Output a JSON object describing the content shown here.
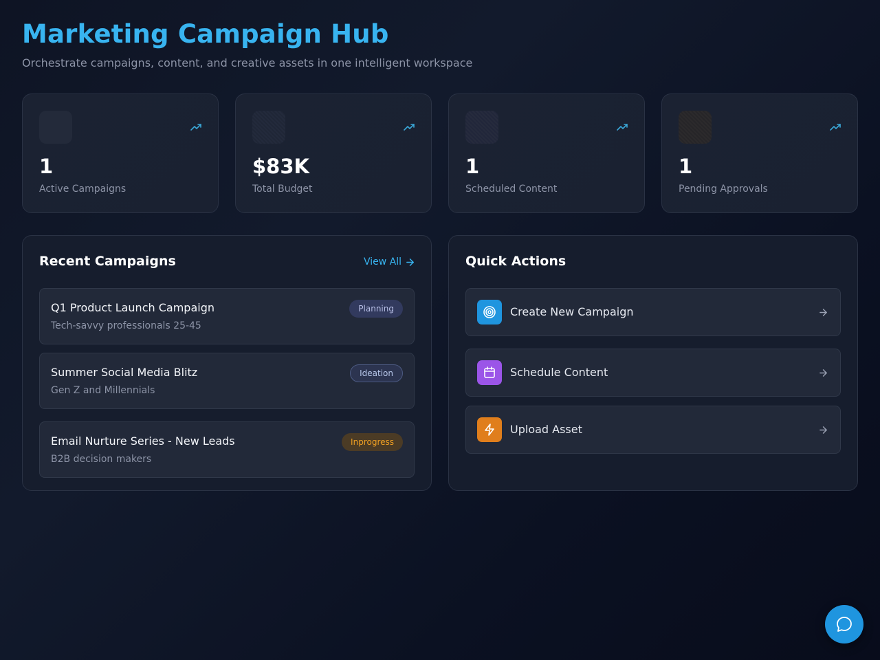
{
  "header": {
    "title": "Marketing Campaign Hub",
    "subtitle": "Orchestrate campaigns, content, and creative assets in one intelligent workspace"
  },
  "stats": [
    {
      "value": "1",
      "label": "Active Campaigns",
      "icon": "trending-up-icon"
    },
    {
      "value": "$83K",
      "label": "Total Budget",
      "icon": "trending-up-icon"
    },
    {
      "value": "1",
      "label": "Scheduled Content",
      "icon": "trending-up-icon"
    },
    {
      "value": "1",
      "label": "Pending Approvals",
      "icon": "trending-up-icon"
    }
  ],
  "recent_campaigns": {
    "title": "Recent Campaigns",
    "view_all_label": "View All",
    "items": [
      {
        "name": "Q1 Product Launch Campaign",
        "audience": "Tech-savvy professionals 25-45",
        "status": "Planning"
      },
      {
        "name": "Summer Social Media Blitz",
        "audience": "Gen Z and Millennials",
        "status": "Ideation"
      },
      {
        "name": "Email Nurture Series - New Leads",
        "audience": "B2B decision makers",
        "status": "Inprogress"
      }
    ]
  },
  "quick_actions": {
    "title": "Quick Actions",
    "items": [
      {
        "label": "Create New Campaign",
        "icon": "target-icon",
        "color": "#1f95df"
      },
      {
        "label": "Schedule Content",
        "icon": "calendar-icon",
        "color": "#9b55e8"
      },
      {
        "label": "Upload Asset",
        "icon": "lightning-icon",
        "color": "#e07e1c"
      }
    ]
  },
  "colors": {
    "accent": "#38b4f0",
    "background": "#0e1424",
    "card": "#1b2232"
  },
  "chat": {
    "icon": "chat-bubble-icon"
  }
}
